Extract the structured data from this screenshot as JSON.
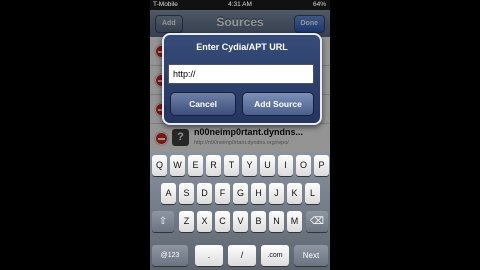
{
  "status_bar": {
    "carrier": "T-Mobile",
    "time": "4:31 AM",
    "battery": "64%"
  },
  "nav": {
    "title": "Sources",
    "add_label": "Add",
    "done_label": "Done"
  },
  "sources": [
    {
      "title": "",
      "subtitle": ""
    },
    {
      "title": "",
      "subtitle": ""
    },
    {
      "title": "",
      "subtitle": ""
    },
    {
      "title": "n00neimp0rtant.dyndns...",
      "subtitle": "http://n00neimp0rtant.dyndns.org/repo/"
    }
  ],
  "alert": {
    "title": "Enter Cydia/APT URL",
    "input_value": "http://",
    "cancel_label": "Cancel",
    "add_label": "Add Source"
  },
  "keyboard": {
    "row1": [
      "Q",
      "W",
      "E",
      "R",
      "T",
      "Y",
      "U",
      "I",
      "O",
      "P"
    ],
    "row2": [
      "A",
      "S",
      "D",
      "F",
      "G",
      "H",
      "J",
      "K",
      "L"
    ],
    "row3": [
      "Z",
      "X",
      "C",
      "V",
      "B",
      "N",
      "M"
    ],
    "numbers_label": "@123",
    "dot_label": ".",
    "slash_label": "/",
    "com_label": ".com",
    "next_label": "Next"
  }
}
